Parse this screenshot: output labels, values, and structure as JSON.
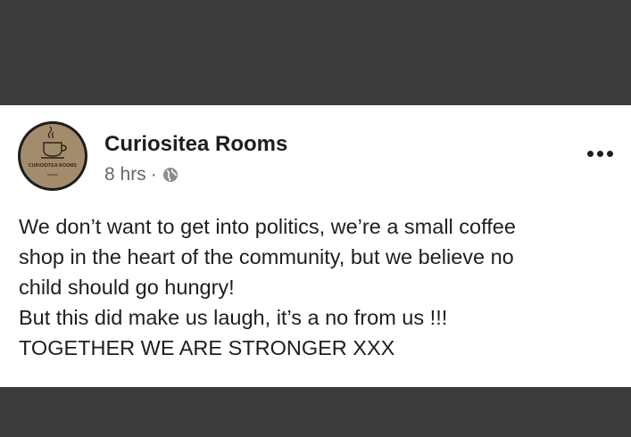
{
  "post": {
    "author": "Curiositea Rooms",
    "avatar_label": "CURIOSITEA ROOMS",
    "time": "8 hrs",
    "separator": "·",
    "privacy_icon": "globe-icon",
    "more_icon": "more-options-icon",
    "text_lines": [
      "We don’t want to get into politics, we’re a small coffee",
      "shop in the heart of the community, but we believe no",
      "child should go hungry!",
      "But this did make us laugh, it’s a no from us !!!",
      "TOGETHER WE ARE STRONGER XXX"
    ]
  },
  "colors": {
    "background": "#3c3c3c",
    "card": "#ffffff",
    "text": "#1c1e21",
    "meta": "#65676b",
    "avatar_bg": "#a38c6b"
  }
}
